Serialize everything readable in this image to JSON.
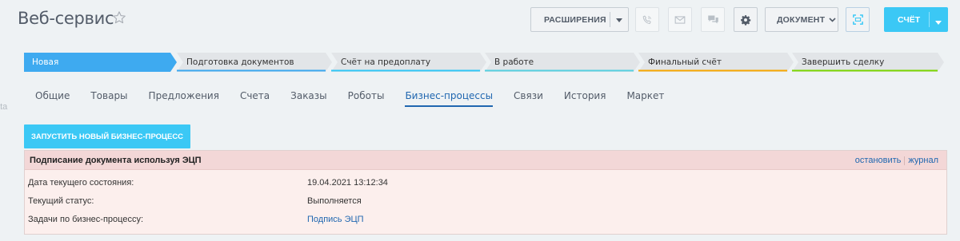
{
  "sidebar": {
    "fragment": "ata"
  },
  "header": {
    "title": "Веб-сервис",
    "star_icon": "star-outline-icon"
  },
  "toolbar": {
    "extensions_label": "РАСШИРЕНИЯ",
    "document_label": "ДОКУМЕНТ",
    "invoice_label": "СЧЁТ",
    "icons": [
      "phone-icon",
      "mail-icon",
      "chat-icon",
      "gear-icon",
      "scan-icon"
    ]
  },
  "stages": [
    {
      "label": "Новая",
      "color": "#3eaaf0",
      "active": true
    },
    {
      "label": "Подготовка документов",
      "color": "#39a8ef"
    },
    {
      "label": "Счёт на предоплату",
      "color": "#2fc6f6"
    },
    {
      "label": "В работе",
      "color": "#55d0e0"
    },
    {
      "label": "Финальный счёт",
      "color": "#f7a700"
    },
    {
      "label": "Завершить сделку",
      "color": "#7bd500"
    }
  ],
  "tabs": [
    {
      "label": "Общие"
    },
    {
      "label": "Товары"
    },
    {
      "label": "Предложения"
    },
    {
      "label": "Счета"
    },
    {
      "label": "Заказы"
    },
    {
      "label": "Роботы"
    },
    {
      "label": "Бизнес-процессы",
      "active": true
    },
    {
      "label": "Связи"
    },
    {
      "label": "История"
    },
    {
      "label": "Маркет"
    }
  ],
  "bp": {
    "start_label": "ЗАПУСТИТЬ НОВЫЙ БИЗНЕС-ПРОЦЕСС",
    "process_title": "Подписание документа используя ЭЦП",
    "stop_label": "остановить",
    "log_label": "журнал",
    "rows": [
      {
        "label": "Дата текущего состояния:",
        "value": "19.04.2021 13:12:34"
      },
      {
        "label": "Текущий статус:",
        "value": "Выполняется"
      },
      {
        "label": "Задачи по бизнес-процессу:",
        "value": "Подпись ЭЦП"
      }
    ]
  }
}
